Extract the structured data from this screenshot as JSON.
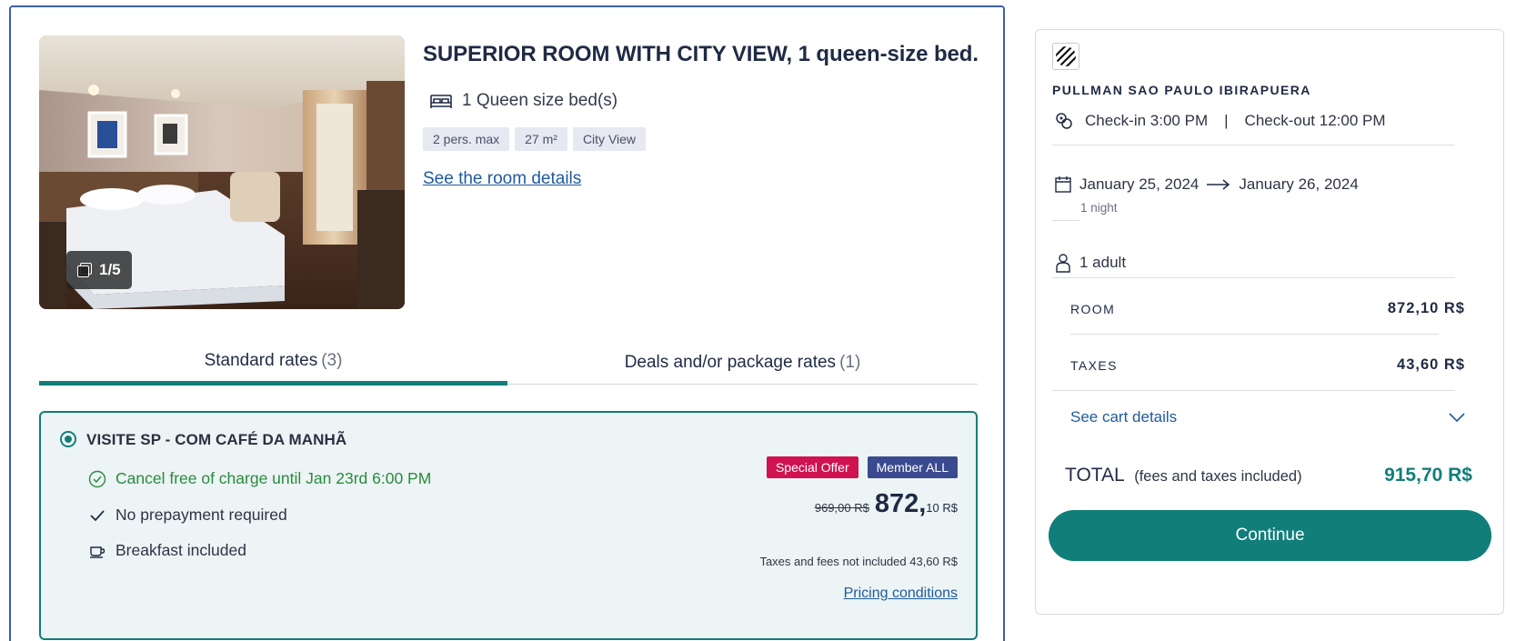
{
  "room": {
    "title": "SUPERIOR ROOM WITH CITY VIEW, 1 queen-size bed.",
    "bed": "1 Queen size bed(s)",
    "tags": [
      "2 pers. max",
      "27 m²",
      "City View"
    ],
    "details_link": "See the room details",
    "photo_counter": "1/5"
  },
  "tabs": [
    {
      "label": "Standard rates",
      "count": "(3)",
      "active": true
    },
    {
      "label": "Deals and/or package rates",
      "count": "(1)",
      "active": false
    }
  ],
  "rate": {
    "name": "VISITE SP - COM CAFÉ DA MANHÃ",
    "features": [
      {
        "icon": "check-circle-icon",
        "text": "Cancel free of charge until Jan 23rd 6:00 PM"
      },
      {
        "icon": "checkmark-icon",
        "text": "No prepayment required"
      },
      {
        "icon": "coffee-cup-icon",
        "text": "Breakfast included"
      }
    ],
    "badges": [
      "Special Offer",
      "Member ALL"
    ],
    "old_price": "969,00 R$",
    "price_int": "872,",
    "price_dec": "10 R$",
    "taxes_note": "Taxes and fees not included 43,60 R$",
    "pricing_link": "Pricing conditions"
  },
  "summary": {
    "hotel_name": "PULLMAN SAO PAULO IBIRAPUERA",
    "checkin": "Check-in 3:00 PM",
    "separator": "|",
    "checkout": "Check-out 12:00 PM",
    "date_from": "January 25, 2024",
    "date_to": "January 26, 2024",
    "nights": "1 night",
    "guests": "1 adult",
    "room_label": "ROOM",
    "room_amount": "872,10 R$",
    "taxes_label": "TAXES",
    "taxes_amount": "43,60 R$",
    "cart_details": "See cart details",
    "total_label": "TOTAL",
    "total_sub": "(fees and taxes included)",
    "total_amount": "915,70 R$",
    "continue_label": "Continue"
  },
  "colors": {
    "accent": "#117e7a",
    "link": "#1f5a9c",
    "offer": "#d11251",
    "member": "#3b4a8f",
    "card_border": "#3d5fb3"
  }
}
